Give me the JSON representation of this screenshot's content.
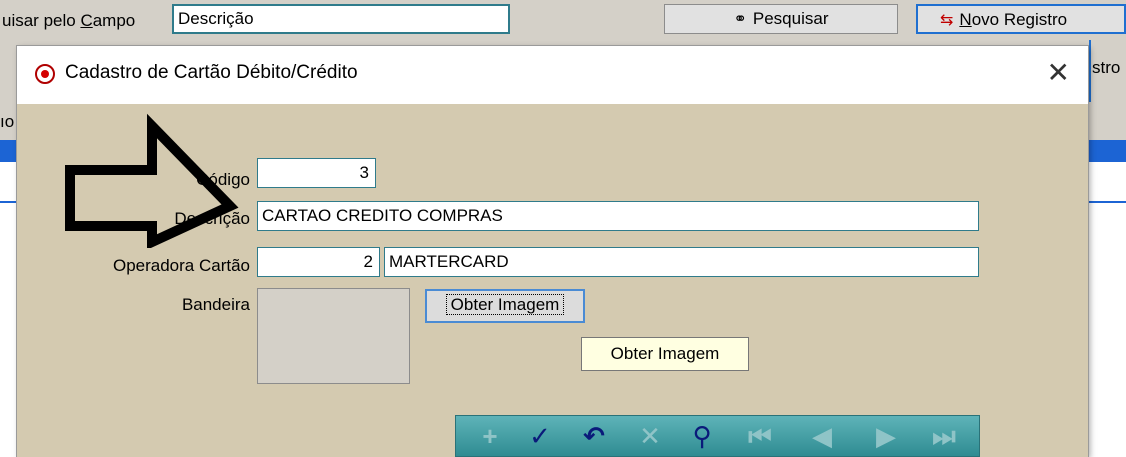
{
  "background": {
    "search_label_pre": "uisar  pelo ",
    "search_label_key": "C",
    "search_label_post": "ampo",
    "search_value": "Descrição",
    "search_button": "Pesquisar",
    "new_record_key": "N",
    "new_record_rest": "ovo Registro",
    "right_fragment": "stro",
    "left_fragment": "ıo"
  },
  "dialog": {
    "title": "Cadastro de Cartão Débito/Crédito",
    "close_symbol": "✕",
    "fields": {
      "codigo_label": "Código",
      "codigo_value": "3",
      "descricao_label": "Descrição",
      "descricao_value": "CARTAO CREDITO COMPRAS",
      "operadora_label": "Operadora Cartão",
      "operadora_code": "2",
      "operadora_name": "MARTERCARD",
      "bandeira_label": "Bandeira"
    },
    "obter_button": "Obter Imagem",
    "tooltip": "Obter Imagem"
  },
  "navigator": {
    "buttons": [
      {
        "name": "add",
        "glyph": "+",
        "state": "dim"
      },
      {
        "name": "confirm",
        "glyph": "✓",
        "state": "active"
      },
      {
        "name": "undo",
        "glyph": "↶",
        "state": "active"
      },
      {
        "name": "delete",
        "glyph": "✕",
        "state": "dim"
      },
      {
        "name": "search",
        "glyph": "⚲",
        "state": "active"
      },
      {
        "name": "first",
        "glyph": "⏮",
        "state": "dim"
      },
      {
        "name": "prior",
        "glyph": "◀",
        "state": "dim"
      },
      {
        "name": "next",
        "glyph": "▶",
        "state": "dim"
      },
      {
        "name": "last",
        "glyph": "⏭",
        "state": "dim"
      }
    ]
  },
  "colors": {
    "dialog_bg": "#d4cab0",
    "field_border": "#2f7b8b",
    "nav_bg": "#3f9ca2",
    "accent_blue": "#1c64d4"
  }
}
